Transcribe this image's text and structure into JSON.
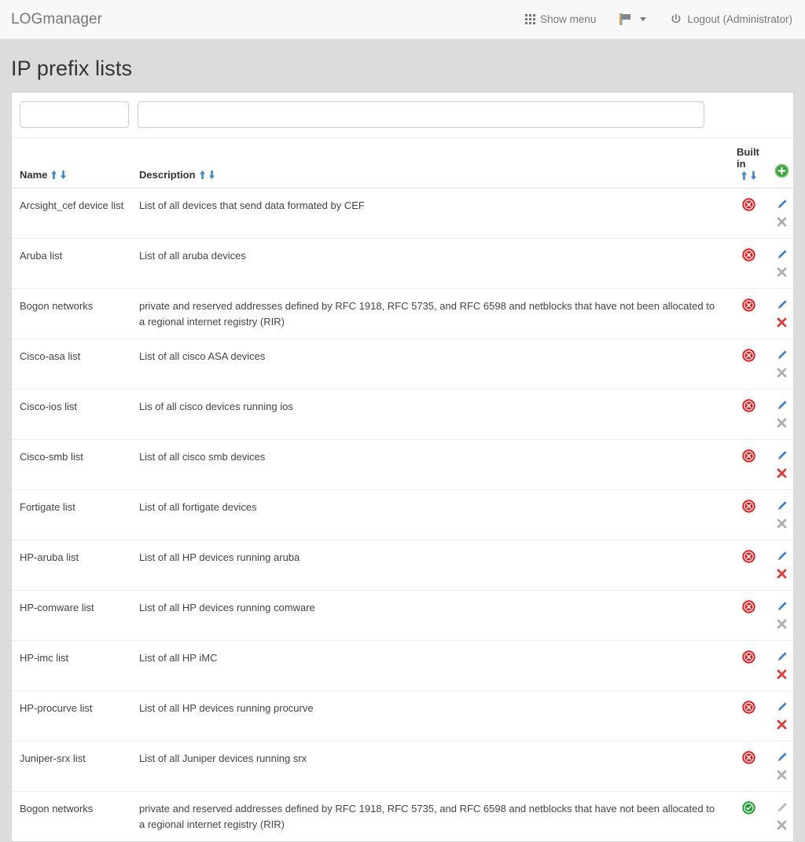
{
  "navbar": {
    "brand": "LOGmanager",
    "show_menu_label": "Show menu",
    "show_menu_icon": "grid-icon",
    "flag_icon": "flag-icon",
    "flag_caret_icon": "chevron-down-icon",
    "logout_label": "Logout (Administrator)",
    "logout_icon": "power-icon"
  },
  "page": {
    "title": "IP prefix lists"
  },
  "filters": {
    "name_value": "",
    "name_placeholder": "",
    "description_value": "",
    "description_placeholder": ""
  },
  "table": {
    "headers": {
      "name": "Name",
      "description": "Description",
      "built_in": "Built in"
    },
    "sort_asc_icon": "sort-ascending-arrow-icon",
    "sort_desc_icon": "sort-descending-arrow-icon",
    "add_icon": "add-circle-plus-icon",
    "icons": {
      "built_in_false": "red-circle-x-icon",
      "built_in_true": "green-circle-check-icon",
      "edit": "pencil-edit-icon",
      "delete": "x-delete-icon"
    },
    "rows": [
      {
        "name": "Arcsight_cef device list",
        "description": "List of all devices that send data formated by CEF",
        "built_in": false,
        "edit_enabled": true,
        "delete_enabled": false
      },
      {
        "name": "Aruba list",
        "description": "List of all aruba devices",
        "built_in": false,
        "edit_enabled": true,
        "delete_enabled": false
      },
      {
        "name": "Bogon networks",
        "description": "private and reserved addresses defined by RFC 1918, RFC 5735, and RFC 6598 and netblocks that have not been allocated to a regional internet registry (RIR)",
        "built_in": false,
        "edit_enabled": true,
        "delete_enabled": true
      },
      {
        "name": "Cisco-asa list",
        "description": "List of all cisco ASA devices",
        "built_in": false,
        "edit_enabled": true,
        "delete_enabled": false
      },
      {
        "name": "Cisco-ios list",
        "description": "Lis of all cisco devices running ios",
        "built_in": false,
        "edit_enabled": true,
        "delete_enabled": false
      },
      {
        "name": "Cisco-smb list",
        "description": "List of all cisco smb devices",
        "built_in": false,
        "edit_enabled": true,
        "delete_enabled": true
      },
      {
        "name": "Fortigate list",
        "description": "List of all fortigate devices",
        "built_in": false,
        "edit_enabled": true,
        "delete_enabled": false
      },
      {
        "name": "HP-aruba list",
        "description": "List of all HP devices running aruba",
        "built_in": false,
        "edit_enabled": true,
        "delete_enabled": true
      },
      {
        "name": "HP-comware list",
        "description": "List of all HP devices running comware",
        "built_in": false,
        "edit_enabled": true,
        "delete_enabled": false
      },
      {
        "name": "HP-imc list",
        "description": "List of all HP iMC",
        "built_in": false,
        "edit_enabled": true,
        "delete_enabled": true
      },
      {
        "name": "HP-procurve list",
        "description": "List of all HP devices running procurve",
        "built_in": false,
        "edit_enabled": true,
        "delete_enabled": true
      },
      {
        "name": "Juniper-srx list",
        "description": "List of all Juniper devices running srx",
        "built_in": false,
        "edit_enabled": true,
        "delete_enabled": false
      },
      {
        "name": "Bogon networks",
        "description": "private and reserved addresses defined by RFC 1918, RFC 5735, and RFC 6598 and netblocks that have not been allocated to a regional internet registry (RIR)",
        "built_in": true,
        "edit_enabled": false,
        "delete_enabled": false
      }
    ]
  },
  "colors": {
    "navbar_bg": "#f8f8f8",
    "page_bg": "#dcdcdc",
    "panel_bg": "#ffffff",
    "muted_text": "#777777",
    "sort_arrow": "#3a87cd",
    "status_false": "#e81b1b",
    "status_true": "#1a9d2e",
    "edit_icon": "#3a87cd",
    "delete_enabled": "#d9433b",
    "delete_disabled": "#b0b0b0"
  }
}
